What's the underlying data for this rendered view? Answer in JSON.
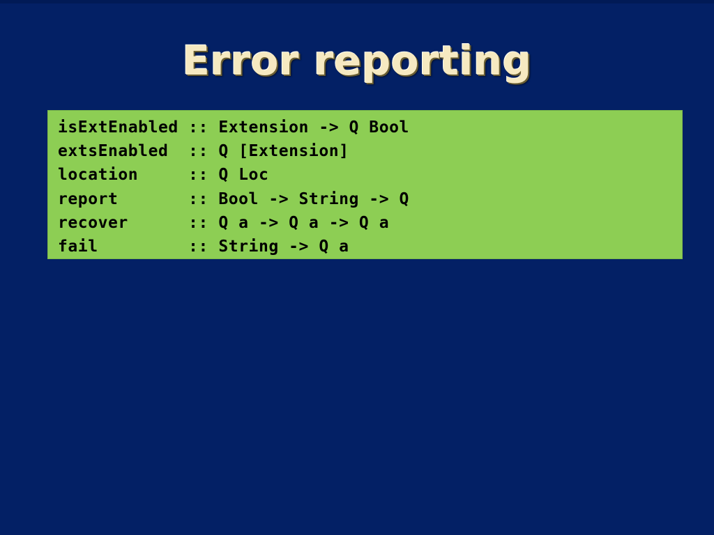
{
  "slide": {
    "title": "Error reporting",
    "background_color": "#032065",
    "title_color": "#f6e9c1"
  },
  "code_block": {
    "background_color": "#8dce54",
    "text_color": "#000000",
    "language": "haskell",
    "lines": [
      "isExtEnabled :: Extension -> Q Bool",
      "extsEnabled  :: Q [Extension]",
      "location     :: Q Loc",
      "report       :: Bool -> String -> Q",
      "recover      :: Q a -> Q a -> Q a",
      "fail         :: String -> Q a"
    ]
  }
}
